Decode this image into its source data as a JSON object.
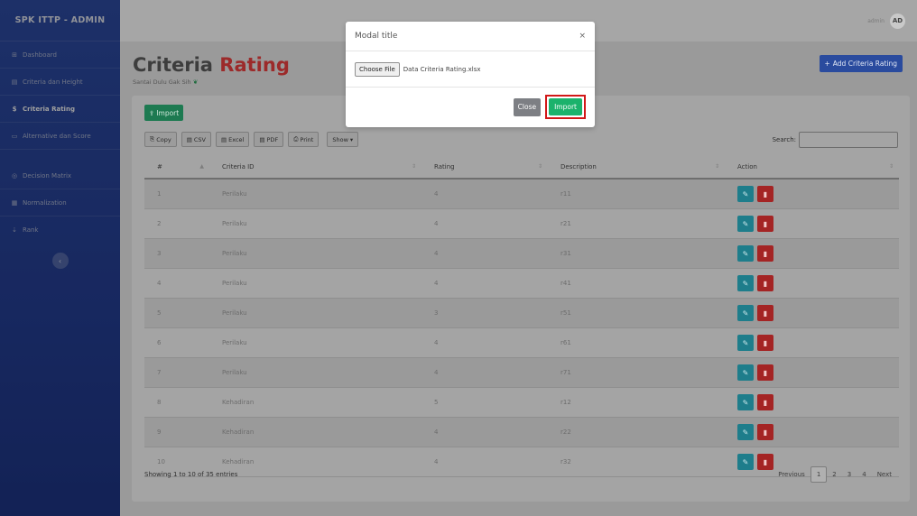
{
  "sidebar": {
    "brand": "SPK ITTP - ADMIN",
    "items": [
      {
        "icon": "⊞",
        "label": "Dashboard"
      },
      {
        "icon": "▤",
        "label": "Criteria dan Height"
      },
      {
        "icon": "$",
        "label": "Criteria Rating"
      },
      {
        "icon": "▭",
        "label": "Alternative dan Score"
      },
      {
        "icon": "◎",
        "label": "Decision Matrix"
      },
      {
        "icon": "▦",
        "label": "Normalization"
      },
      {
        "icon": "⇣",
        "label": "Rank"
      }
    ],
    "collapse_icon": "‹"
  },
  "topbar": {
    "admin_name": "admin",
    "avatar_initials": "AD"
  },
  "page": {
    "title_part1": "Criteria ",
    "title_part2": "Rating",
    "subtitle": "Santai Dulu Gak Sih",
    "subtitle_icon": "❦",
    "add_button": "Add Criteria Rating",
    "add_icon": "+"
  },
  "toolbar": {
    "import_label": "Import",
    "buttons": [
      {
        "icon": "⎘",
        "label": "Copy"
      },
      {
        "icon": "▤",
        "label": "CSV"
      },
      {
        "icon": "▤",
        "label": "Excel"
      },
      {
        "icon": "▤",
        "label": "PDF"
      },
      {
        "icon": "⎙",
        "label": "Print"
      }
    ],
    "show_label": "Show",
    "show_caret": "▾",
    "search_label": "Search:"
  },
  "table": {
    "headers": [
      "#",
      "Criteria ID",
      "Rating",
      "Description",
      "Action"
    ],
    "rows": [
      {
        "no": "1",
        "criteria": "Perilaku",
        "rating": "4",
        "desc": "r11"
      },
      {
        "no": "2",
        "criteria": "Perilaku",
        "rating": "4",
        "desc": "r21"
      },
      {
        "no": "3",
        "criteria": "Perilaku",
        "rating": "4",
        "desc": "r31"
      },
      {
        "no": "4",
        "criteria": "Perilaku",
        "rating": "4",
        "desc": "r41"
      },
      {
        "no": "5",
        "criteria": "Perilaku",
        "rating": "3",
        "desc": "r51"
      },
      {
        "no": "6",
        "criteria": "Perilaku",
        "rating": "4",
        "desc": "r61"
      },
      {
        "no": "7",
        "criteria": "Perilaku",
        "rating": "4",
        "desc": "r71"
      },
      {
        "no": "8",
        "criteria": "Kehadiran",
        "rating": "5",
        "desc": "r12"
      },
      {
        "no": "9",
        "criteria": "Kehadiran",
        "rating": "4",
        "desc": "r22"
      },
      {
        "no": "10",
        "criteria": "Kehadiran",
        "rating": "4",
        "desc": "r32"
      }
    ]
  },
  "footer": {
    "info": "Showing 1 to 10 of 35 entries",
    "previous": "Previous",
    "pages": [
      "1",
      "2",
      "3",
      "4"
    ],
    "next": "Next"
  },
  "modal": {
    "title": "Modal title",
    "close_x": "×",
    "choose_file": "Choose File",
    "file_name": "Data Criteria Rating.xlsx",
    "close_button": "Close",
    "import_button": "Import"
  }
}
